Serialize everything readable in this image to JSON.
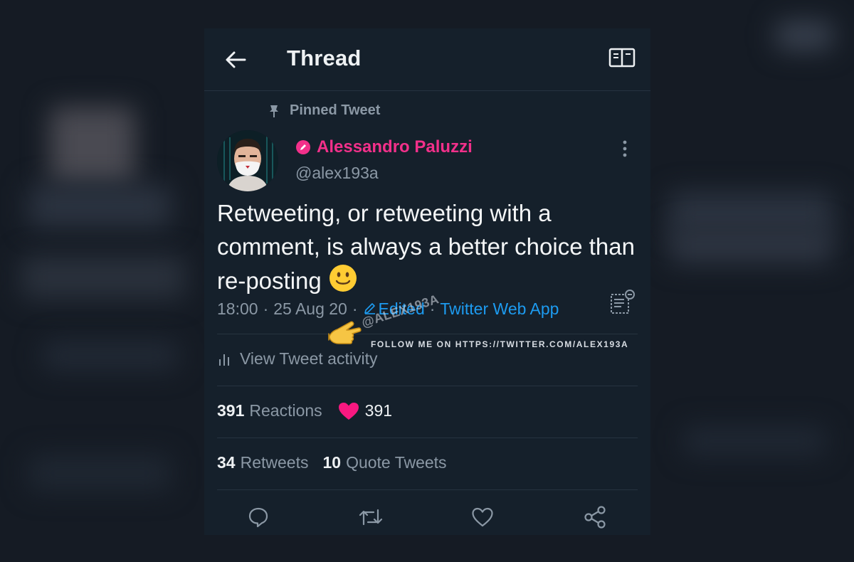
{
  "header": {
    "title": "Thread",
    "back_icon": "arrow-left-icon",
    "reader_icon": "book-open-icon"
  },
  "tweet": {
    "pinned_label": "Pinned Tweet",
    "author_name": "Alessandro Paluzzi",
    "author_handle": "@alex193a",
    "text": "Retweeting, or retweeting with a comment, is always a better choice than re-posting",
    "emoji": "slightly-smiling-face",
    "time": "18:00",
    "date": "25 Aug 20",
    "edited_label": "Edited",
    "source": "Twitter Web App",
    "activity_label": "View Tweet activity"
  },
  "stats": {
    "reactions_count": "391",
    "reactions_label": "Reactions",
    "likes_count": "391",
    "retweets_count": "34",
    "retweets_label": "Retweets",
    "quotes_count": "10",
    "quotes_label": "Quote Tweets"
  },
  "actions": [
    {
      "name": "reply",
      "icon": "comment-icon"
    },
    {
      "name": "retweet",
      "icon": "retweet-icon"
    },
    {
      "name": "like",
      "icon": "heart-outline-icon"
    },
    {
      "name": "share",
      "icon": "share-icon"
    }
  ],
  "watermark": {
    "handle": "@ALEX193A",
    "follow_text": "FOLLOW ME ON HTTPS://TWITTER.COM/ALEX193A"
  },
  "colors": {
    "background": "#15202b",
    "accent_blue": "#1d9bf0",
    "author_pink": "#f2308a",
    "heart_pink": "#f91880",
    "muted": "#8b98a5"
  }
}
